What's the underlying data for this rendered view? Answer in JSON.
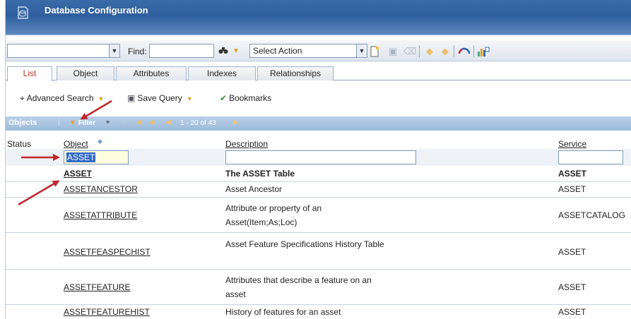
{
  "window": {
    "title": "Database Configuration"
  },
  "toolbar": {
    "find_label": "Find:",
    "find_value": "",
    "action_select": "Select Action"
  },
  "tabs": [
    {
      "label": "List",
      "active": true
    },
    {
      "label": "Object",
      "active": false
    },
    {
      "label": "Attributes",
      "active": false
    },
    {
      "label": "Indexes",
      "active": false
    },
    {
      "label": "Relationships",
      "active": false
    }
  ],
  "actions": {
    "advanced_search": "Advanced Search",
    "save_query": "Save Query",
    "bookmarks": "Bookmarks"
  },
  "objects_bar": {
    "label": "Objects",
    "filter": "Filter",
    "count": "1 - 20 of 43"
  },
  "table": {
    "headers": {
      "status": "Status",
      "object": "Object",
      "description": "Description",
      "service": "Service"
    },
    "filters": {
      "object": "ASSET",
      "description": "",
      "service": ""
    },
    "rows": [
      {
        "object": "ASSET",
        "description": "The ASSET Table",
        "service": "ASSET",
        "bold": true
      },
      {
        "object": "ASSETANCESTOR",
        "description": "Asset Ancestor",
        "service": "ASSET"
      },
      {
        "object": "ASSETATTRIBUTE",
        "description": "Attribute or property of an Asset(Item;As;Loc)",
        "service": "ASSETCATALOG"
      },
      {
        "object": "ASSETFEASPECHIST",
        "description": "Asset Feature Specifications History Table",
        "service": "ASSET"
      },
      {
        "object": "ASSETFEATURE",
        "description": "Attributes that describe a feature on an asset",
        "service": "ASSET"
      },
      {
        "object": "ASSETFEATUREHIST",
        "description": "History of features for an asset",
        "service": "ASSET"
      }
    ]
  },
  "colors": {
    "title_bar": "#2f5f9d",
    "objects_bar": "#9dbbdc",
    "active_tab_text": "#c0392b",
    "annotation_arrow": "#c0282d"
  }
}
